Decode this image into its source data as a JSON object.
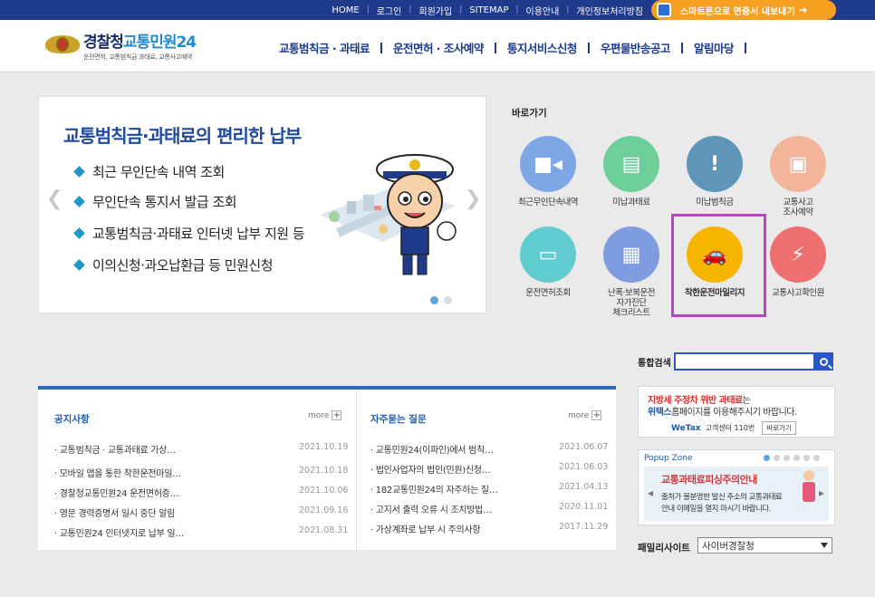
{
  "util_links": [
    "HOME",
    "로그인",
    "회원가입",
    "SITEMAP",
    "이용안내",
    "개인정보처리방침"
  ],
  "smart_banner": "스마트폰으로 면증서 내보내기",
  "logo": {
    "title_a": "경찰청",
    "title_b": "교통민원24",
    "sub": "운전면허, 교통범칙금 과태료, 교통사고예약"
  },
  "gnb": [
    "교통범칙금 · 과태료",
    "운전면허 · 조사예약",
    "통지서비스신청",
    "우편물반송공고",
    "알림마당"
  ],
  "slider": {
    "title": "교통범칙금·과태료의 편리한 납부",
    "items": [
      "최근 무인단속 내역 조회",
      "무인단속 통지서 발급 조회",
      "교통범칙금·과태료 인터넷 납부 지원 등",
      "이의신청·과오납환급 등 민원신청"
    ],
    "active_dot": 1,
    "dot_count": 2
  },
  "quick": {
    "title": "바로가기",
    "items": [
      {
        "label": "최근무인단속내역",
        "color": "#7ea7e6",
        "icon": "camera-icon"
      },
      {
        "label": "미납과태료",
        "color": "#6fcf9b",
        "icon": "money-icon"
      },
      {
        "label": "미납범칙금",
        "color": "#5e95b8",
        "icon": "warning-icon"
      },
      {
        "label": "교통사고\n조사예약",
        "color": "#f2b49a",
        "icon": "monitor-icon"
      },
      {
        "label": "운전면허조회",
        "color": "#62cdd0",
        "icon": "id-card-icon"
      },
      {
        "label": "난폭·보복운전\n자가진단\n체크리스트",
        "color": "#7f9ce0",
        "icon": "checklist-icon"
      },
      {
        "label": "착한운전마일리지",
        "color": "#f7b500",
        "icon": "car-mileage-icon"
      },
      {
        "label": "교통사고확인원",
        "color": "#ef7070",
        "icon": "crash-icon"
      }
    ]
  },
  "search": {
    "label": "통합검색",
    "placeholder": ""
  },
  "notice": {
    "title": "공지사항",
    "more": "more",
    "rows": [
      {
        "t": "교통범칙금 · 교통과태료 가상…",
        "d": "2021.10.19"
      },
      {
        "t": "모바일 앱을 통한 착한운전마일…",
        "d": "2021.10.18"
      },
      {
        "t": "경찰청교통민원24 운전면허증…",
        "d": "2021.10.06"
      },
      {
        "t": "영문 경력증명서 일시 중단 알림",
        "d": "2021.09.16"
      },
      {
        "t": "교통민원24 인터넷지로 납부 일…",
        "d": "2021.08.31"
      }
    ]
  },
  "faq": {
    "title": "자주묻는 질문",
    "more": "more",
    "rows": [
      {
        "t": "교통민원24(이파인)에서 범칙…",
        "d": "2021.06.07"
      },
      {
        "t": "법인사업자의 법인(민원)신청…",
        "d": "2021.06.03"
      },
      {
        "t": "182교통민원24의 자주하는 질…",
        "d": "2021.04.13"
      },
      {
        "t": "고지서 출력 오류 시 조치방법…",
        "d": "2020.11.01"
      },
      {
        "t": "가상계좌로 납부 시 주의사항",
        "d": "2017.11.29"
      }
    ]
  },
  "banner1": {
    "l1_red": "지방세 주정차 위반 과태료",
    "l1_rest": "는",
    "l2_blue": "위택스",
    "l2_rest": "홈페이지를 이용해주시기 바랍니다.",
    "wetax": "WeTax",
    "center": "고객센터 110번",
    "go": "바로가기"
  },
  "banner2": {
    "zone": "Popup Zone",
    "head": "교통과태료피싱주의안내",
    "b1": "출처가 불분명한 발신 주소의 교통과태료",
    "b2": "안내 이메일을 열지 마시기 바랍니다.",
    "dot_count": 6,
    "active_dot": 1
  },
  "family": {
    "label": "패밀리사이트",
    "selected": "사이버경찰청"
  }
}
